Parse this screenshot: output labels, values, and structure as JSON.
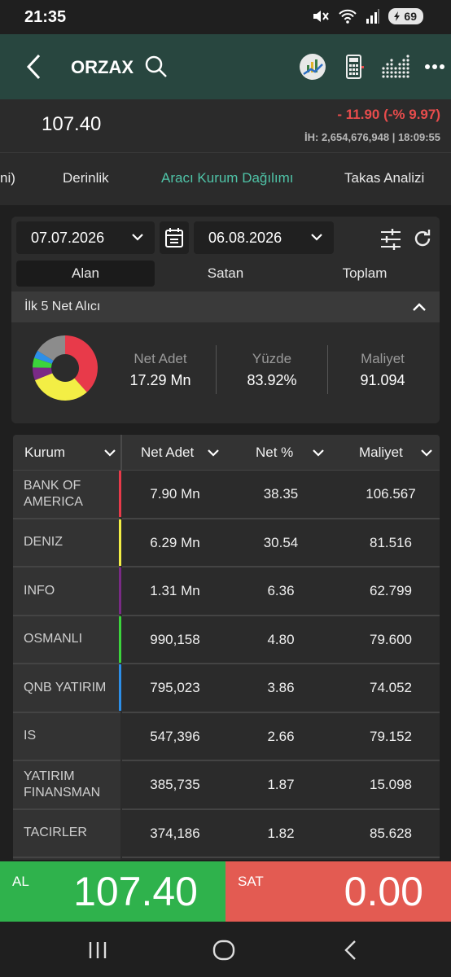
{
  "status_bar": {
    "time": "21:35",
    "battery": "69"
  },
  "header": {
    "title": "ORZAX"
  },
  "price": {
    "last": "107.40",
    "change": "- 11.90 (-% 9.97)",
    "volume_time": "İH: 2,654,676,948 | 18:09:55"
  },
  "tabs": [
    "ni)",
    "Derinlik",
    "Aracı Kurum Dağılımı",
    "Takas Analizi"
  ],
  "filters": {
    "start_date": "07.07.2026",
    "end_date": "06.08.2026",
    "segments": [
      "Alan",
      "Satan",
      "Toplam"
    ],
    "active_segment": "Alan"
  },
  "summary": {
    "section_title": "İlk 5 Net Alıcı",
    "stats": [
      {
        "label": "Net Adet",
        "value": "17.29 Mn"
      },
      {
        "label": "Yüzde",
        "value": "83.92%"
      },
      {
        "label": "Maliyet",
        "value": "91.094"
      }
    ],
    "donut": [
      {
        "value": 38.35,
        "color": "#e83a4a"
      },
      {
        "value": 30.54,
        "color": "#f3ee45"
      },
      {
        "value": 6.36,
        "color": "#7a2a86"
      },
      {
        "value": 4.8,
        "color": "#3cd43c"
      },
      {
        "value": 3.86,
        "color": "#2d8fe8"
      },
      {
        "value": 16.09,
        "color": "#8c8c8c"
      }
    ]
  },
  "table": {
    "headers": [
      "Kurum",
      "Net Adet",
      "Net %",
      "Maliyet"
    ],
    "rows": [
      {
        "name": "BANK OF AMERICA",
        "net": "7.90 Mn",
        "pct": "38.35",
        "cost": "106.567",
        "color": "#e83a4a"
      },
      {
        "name": "DENIZ",
        "net": "6.29 Mn",
        "pct": "30.54",
        "cost": "81.516",
        "color": "#f3ee45"
      },
      {
        "name": "INFO",
        "net": "1.31 Mn",
        "pct": "6.36",
        "cost": "62.799",
        "color": "#7a2a86"
      },
      {
        "name": "OSMANLI",
        "net": "990,158",
        "pct": "4.80",
        "cost": "79.600",
        "color": "#3cd43c"
      },
      {
        "name": "QNB YATIRIM",
        "net": "795,023",
        "pct": "3.86",
        "cost": "74.052",
        "color": "#2d8fe8"
      },
      {
        "name": "IS",
        "net": "547,396",
        "pct": "2.66",
        "cost": "79.152",
        "color": ""
      },
      {
        "name": "YATIRIM FINANSMAN",
        "net": "385,735",
        "pct": "1.87",
        "cost": "15.098",
        "color": ""
      },
      {
        "name": "TACIRLER",
        "net": "374,186",
        "pct": "1.82",
        "cost": "85.628",
        "color": ""
      },
      {
        "name": "",
        "net": "",
        "pct": "",
        "cost": "",
        "color": ""
      }
    ]
  },
  "trade": {
    "buy_label": "AL",
    "buy_price": "107.40",
    "sell_label": "SAT",
    "sell_price": "0.00"
  }
}
